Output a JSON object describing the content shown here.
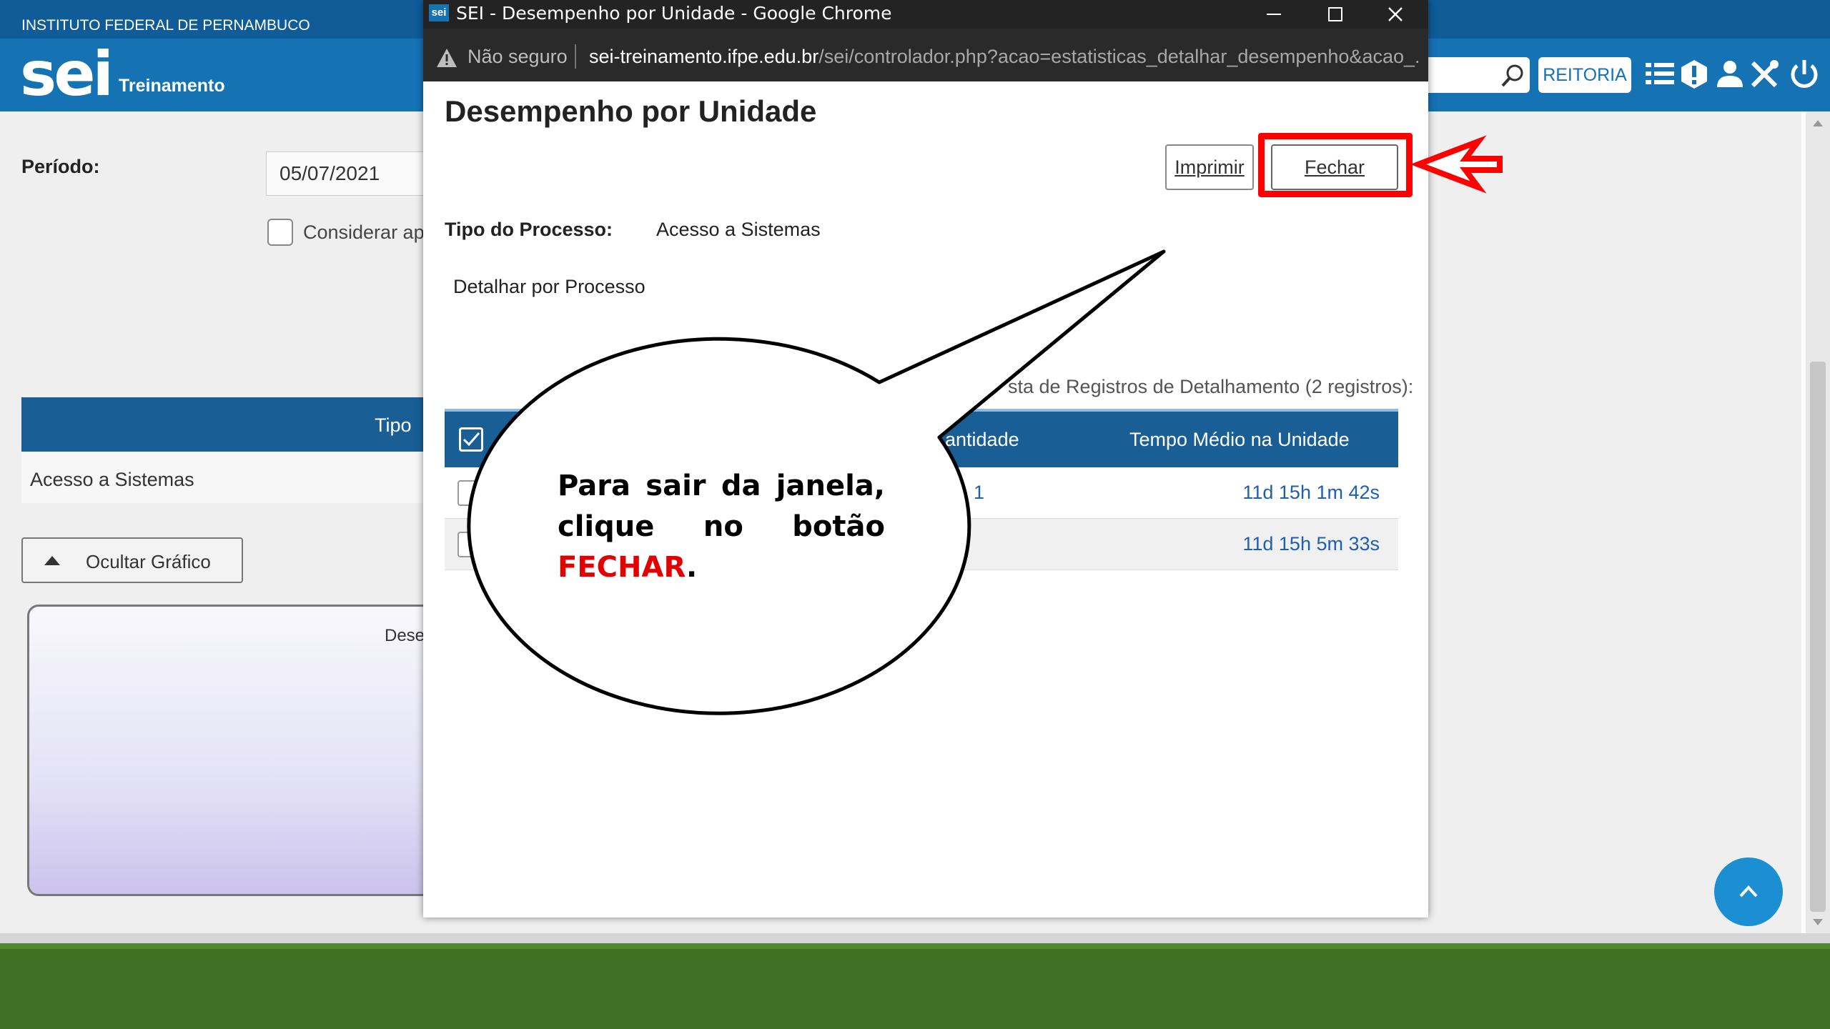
{
  "background": {
    "institution": "INSTITUTO FEDERAL DE PERNAMBUCO",
    "logo_text": "sei",
    "environment": "Treinamento",
    "unit_button": "REITORIA",
    "periodo_label": "Período:",
    "periodo_value": "05/07/2021",
    "considerar_label": "Considerar ape",
    "table_header_tipo": "Tipo",
    "table_row": "Acesso a Sistemas",
    "ocultar_label": "Ocultar Gráfico",
    "chart_title_fragment": "Dese"
  },
  "popup": {
    "favicon_text": "sei",
    "window_title": "SEI - Desempenho por Unidade - Google Chrome",
    "not_secure": "Não seguro",
    "url_host": "sei-treinamento.ifpe.edu.br",
    "url_path": "/sei/controlador.php?acao=estatisticas_detalhar_desempenho&acao_...",
    "heading": "Desempenho por Unidade",
    "print_button": "Imprimir",
    "close_button": "Fechar",
    "tipo_label": "Tipo do Processo:",
    "tipo_value": "Acesso a Sistemas",
    "detalhar_label": "Detalhar por Processo",
    "list_caption": "sta de Registros de Detalhamento (2 registros):",
    "table": {
      "col_quantidade": "antidade",
      "col_tempo": "Tempo Médio na Unidade",
      "rows": [
        {
          "quantidade": "1",
          "tempo": "11d 15h 1m 42s"
        },
        {
          "quantidade": "",
          "tempo": "11d 15h 5m 33s"
        }
      ]
    }
  },
  "annotation": {
    "text_before": "Para sair da janela, clique no botão ",
    "highlight": "FECHAR",
    "text_after": ".",
    "highlight_color": "#e20000",
    "box_color": "#ff0000"
  },
  "colors": {
    "sei_blue": "#1572b3",
    "table_header_blue": "#1a5e96",
    "bottom_green": "#3f7024"
  }
}
